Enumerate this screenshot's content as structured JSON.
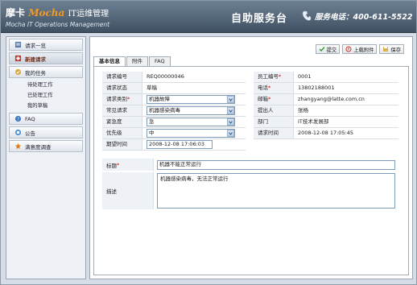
{
  "header": {
    "logo_brand": "摩卡",
    "logo_mocha": "Mocha",
    "logo_suffix": "IT运维管理",
    "logo_sub": "Mocha IT Operations Management",
    "title": "自助服务台",
    "phone": "服务电话：400-611-5522"
  },
  "sidebar": {
    "items": [
      {
        "label": "请求一览",
        "icon": "list-icon"
      },
      {
        "label": "新建请求",
        "icon": "new-request-icon"
      },
      {
        "label": "我的任务",
        "icon": "tasks-icon"
      }
    ],
    "sub_items": [
      "待处理工作",
      "已处理工作",
      "我的草稿"
    ],
    "items2": [
      {
        "label": "FAQ",
        "icon": "faq-icon"
      },
      {
        "label": "公告",
        "icon": "announcement-icon"
      },
      {
        "label": "满意度调查",
        "icon": "survey-icon"
      }
    ]
  },
  "toolbar": {
    "submit": "提交",
    "upload": "上载附件",
    "save": "保存"
  },
  "tabs": [
    "基本信息",
    "附件",
    "FAQ"
  ],
  "form": {
    "left": [
      {
        "label": "请求编号",
        "value": "REQ00000046"
      },
      {
        "label": "请求状态",
        "value": "草稿"
      },
      {
        "label": "请求类别",
        "required": "*",
        "value": "机器故障"
      },
      {
        "label": "常见请求",
        "value": "机器感染病毒"
      },
      {
        "label": "紧急度",
        "value": "急"
      },
      {
        "label": "优先级",
        "value": "中"
      },
      {
        "label": "期望时间",
        "value": "2008-12-08 17:06:03"
      }
    ],
    "right": [
      {
        "label": "员工编号",
        "required": "*",
        "value": "0001"
      },
      {
        "label": "电话",
        "required": "*",
        "value": "13802188001"
      },
      {
        "label": "邮箱",
        "required": "*",
        "value": "zhangyang@latte.com.cn"
      },
      {
        "label": "提出人",
        "value": "张杨"
      },
      {
        "label": "部门",
        "value": "IT技术发展部"
      },
      {
        "label": "请求时间",
        "value": "2008-12-08 17:05:45"
      }
    ],
    "title_label": "标题",
    "title_required": "*",
    "title_value": "机器不能正常运行",
    "desc_label": "描述",
    "desc_value": "机器感染病毒，无法正常运行"
  }
}
